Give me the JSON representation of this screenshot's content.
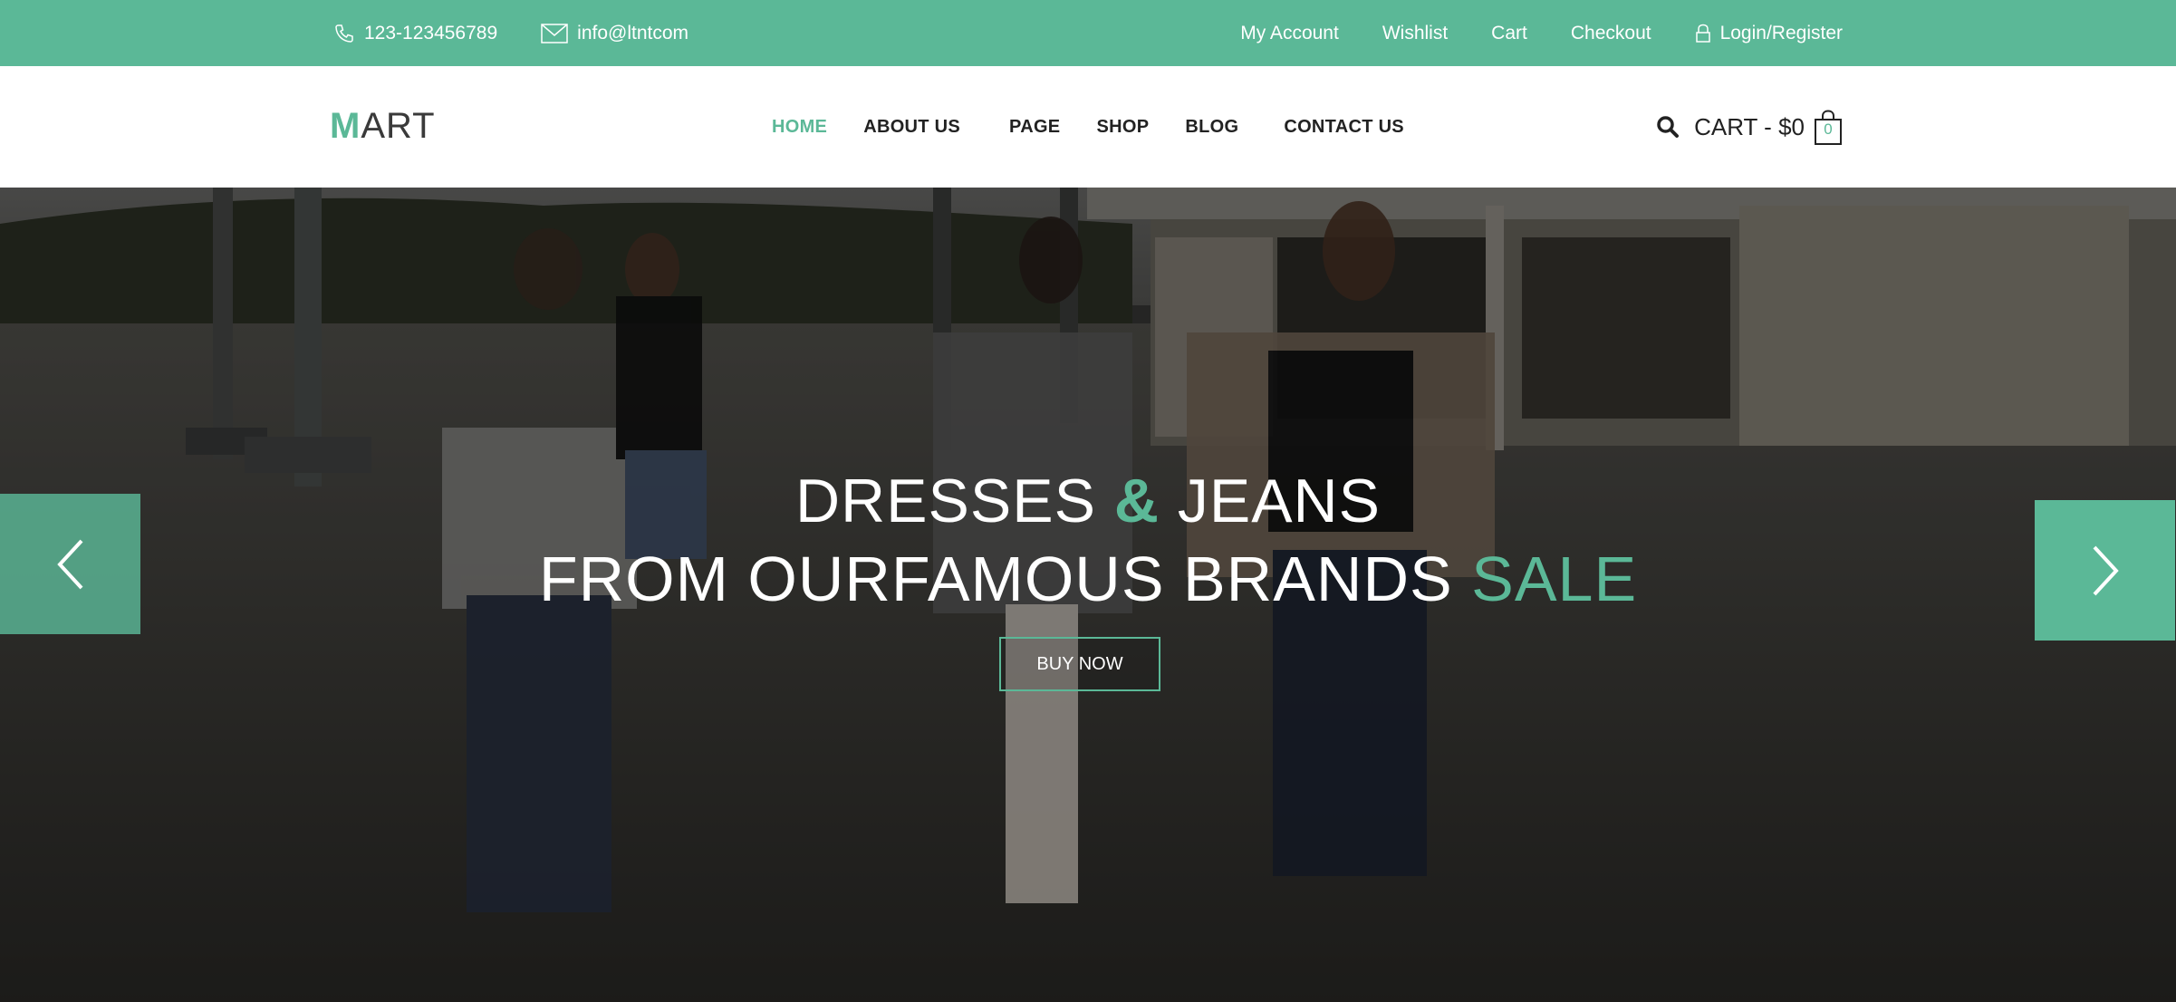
{
  "topbar": {
    "phone": "123-123456789",
    "email": "info@ltntcom",
    "links": {
      "my_account": "My Account",
      "wishlist": "Wishlist",
      "cart": "Cart",
      "checkout": "Checkout",
      "login": "Login/Register"
    }
  },
  "header": {
    "logo_first": "M",
    "logo_rest": "ART",
    "nav": {
      "home": "HOME",
      "about": "ABOUT US",
      "page": "PAGE",
      "shop": "SHOP",
      "blog": "BLOG",
      "contact": "CONTACT US"
    },
    "cart_label": "CART - $0",
    "cart_count": "0"
  },
  "hero": {
    "line1_a": "DRESSES ",
    "line1_amp": "&",
    "line1_b": " JEANS",
    "line2_a": "FROM OURFAMOUS BRANDS ",
    "line2_sale": "SALE",
    "button": "BUY NOW"
  },
  "colors": {
    "accent": "#5bb897",
    "text_dark": "#222222"
  },
  "icons": {
    "phone": "phone-icon",
    "mail": "mail-icon",
    "lock": "lock-icon",
    "search": "search-icon",
    "bag": "shopping-bag-icon",
    "prev": "chevron-left-icon",
    "next": "chevron-right-icon"
  }
}
